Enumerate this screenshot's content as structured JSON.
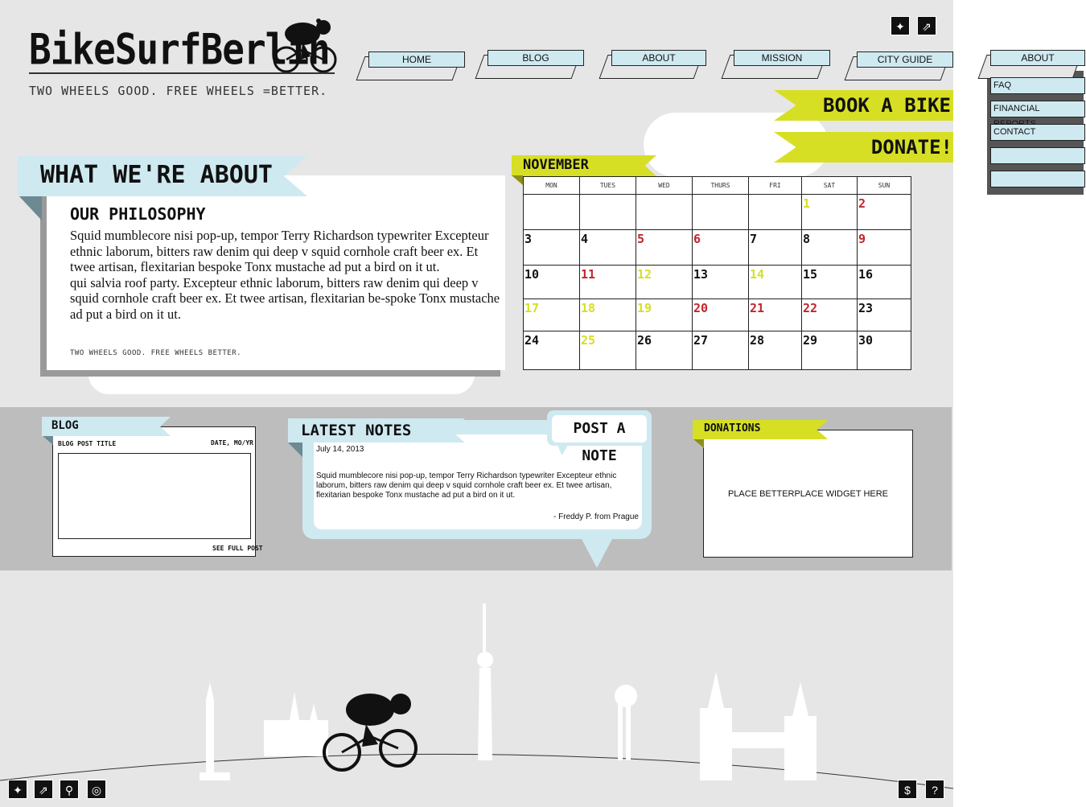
{
  "brand": {
    "logo": "BikeSurfBerlin",
    "tagline": "TWO WHEELS GOOD. FREE WHEELS =BETTER."
  },
  "nav": {
    "items": [
      {
        "label": "HOME"
      },
      {
        "label": "BLOG"
      },
      {
        "label": "ABOUT"
      },
      {
        "label": "MISSION"
      },
      {
        "label": "CITY GUIDE"
      },
      {
        "label": "ABOUT"
      }
    ],
    "dropdown": [
      "FAQ",
      "FINANCIAL REPORTS",
      "CONTACT",
      "",
      ""
    ]
  },
  "top_social": [
    "twitter-icon",
    "link-icon"
  ],
  "actions": {
    "book": "BOOK A BIKE",
    "donate": "DONATE!"
  },
  "about": {
    "title": "WHAT WE'RE ABOUT",
    "subtitle": "OUR PHILOSOPHY",
    "paragraph1": "Squid mumblecore nisi pop-up, tempor Terry Richardson typewriter Excepteur ethnic laborum, bitters raw denim qui deep v squid cornhole craft beer ex. Et twee artisan, flexitarian bespoke Tonx mustache ad put a bird on it ut.",
    "paragraph2": "qui salvia roof party. Excepteur ethnic laborum, bitters raw denim qui deep v squid cornhole craft beer ex. Et twee artisan, flexitarian be-spoke Tonx mustache ad put a bird on it ut.",
    "footer": "TWO WHEELS GOOD. FREE WHEELS BETTER."
  },
  "calendar": {
    "month": "NOVEMBER",
    "weekdays": [
      "MON",
      "TUES",
      "WED",
      "THURS",
      "FRI",
      "SAT",
      "SUN"
    ],
    "weeks": [
      [
        {
          "d": "",
          "c": ""
        },
        {
          "d": "",
          "c": ""
        },
        {
          "d": "",
          "c": ""
        },
        {
          "d": "",
          "c": ""
        },
        {
          "d": "",
          "c": ""
        },
        {
          "d": "1",
          "c": "y"
        },
        {
          "d": "2",
          "c": "r"
        }
      ],
      [
        {
          "d": "3",
          "c": ""
        },
        {
          "d": "4",
          "c": ""
        },
        {
          "d": "5",
          "c": "r"
        },
        {
          "d": "6",
          "c": "r"
        },
        {
          "d": "7",
          "c": ""
        },
        {
          "d": "8",
          "c": ""
        },
        {
          "d": "9",
          "c": "r"
        }
      ],
      [
        {
          "d": "10",
          "c": ""
        },
        {
          "d": "11",
          "c": "r"
        },
        {
          "d": "12",
          "c": "y"
        },
        {
          "d": "13",
          "c": ""
        },
        {
          "d": "14",
          "c": "y"
        },
        {
          "d": "15",
          "c": ""
        },
        {
          "d": "16",
          "c": ""
        }
      ],
      [
        {
          "d": "17",
          "c": "y"
        },
        {
          "d": "18",
          "c": "y"
        },
        {
          "d": "19",
          "c": "y"
        },
        {
          "d": "20",
          "c": "r"
        },
        {
          "d": "21",
          "c": "r"
        },
        {
          "d": "22",
          "c": "r"
        },
        {
          "d": "23",
          "c": ""
        }
      ],
      [
        {
          "d": "24",
          "c": ""
        },
        {
          "d": "25",
          "c": "y"
        },
        {
          "d": "26",
          "c": ""
        },
        {
          "d": "27",
          "c": ""
        },
        {
          "d": "28",
          "c": ""
        },
        {
          "d": "29",
          "c": ""
        },
        {
          "d": "30",
          "c": ""
        }
      ]
    ],
    "colors": {
      "r": "#c0262d",
      "y": "#d6df23",
      "default": "#111111"
    }
  },
  "blog": {
    "label": "BLOG",
    "post_title": "BLOG POST TITLE",
    "date": "DATE, MO/YR",
    "see_full": "SEE FULL POST"
  },
  "notes": {
    "label": "LATEST NOTES",
    "post_button": "POST A NOTE",
    "date": "July 14, 2013",
    "body": "Squid mumblecore nisi pop-up, tempor Terry Richardson typewriter Excepteur ethnic laborum, bitters raw denim qui deep v squid cornhole craft beer ex. Et twee artisan, flexitarian bespoke Tonx mustache ad put a bird on it ut.",
    "author": "- Freddy P. from Prague"
  },
  "donations": {
    "label": "DONATIONS",
    "placeholder": "PLACE BETTERPLACE WIDGET HERE"
  },
  "footer_icons": [
    "twitter-icon",
    "link-icon",
    "map-pin-icon",
    "globe-icon",
    "dollar-icon",
    "help-icon"
  ],
  "colors": {
    "accent_blue": "#cfe9f1",
    "accent_yellow": "#d6df23",
    "background": "#e6e6e6",
    "band": "#bdbdbd"
  }
}
